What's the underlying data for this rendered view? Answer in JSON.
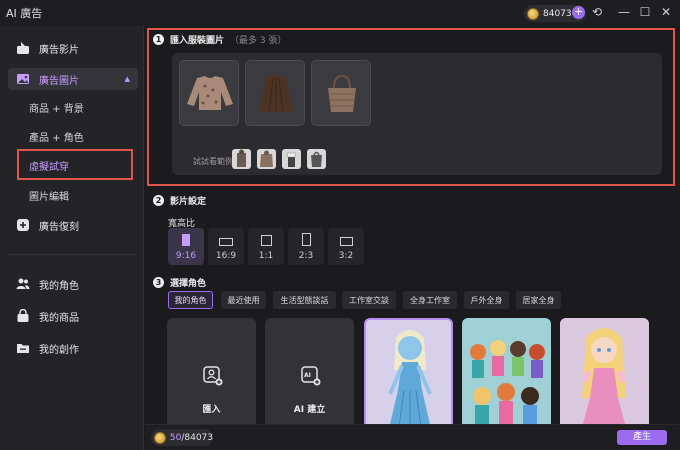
{
  "app": {
    "title": "AI 廣告"
  },
  "titlebar": {
    "credits": "84073",
    "plus": "+",
    "refresh": "⟲",
    "minimize": "—",
    "maximize": "☐",
    "close": "✕"
  },
  "sidebar": {
    "items": [
      {
        "label": "廣告影片"
      },
      {
        "label": "廣告圖片",
        "chevron": "▲"
      },
      {
        "label": "廣告復刻"
      },
      {
        "label": "我的角色"
      },
      {
        "label": "我的商品"
      },
      {
        "label": "我的創作"
      }
    ],
    "sub_items": [
      {
        "label": "商品 + 背景"
      },
      {
        "label": "產品 + 角色"
      },
      {
        "label": "虛擬試穿"
      },
      {
        "label": "圖片編輯"
      }
    ]
  },
  "section1": {
    "number": "1",
    "title": "匯入服裝圖片",
    "hint": "（最多 3 張）",
    "examples_label": "試試看範例:"
  },
  "section2": {
    "number": "2",
    "title": "影片設定",
    "ratio_label": "寬高比",
    "ratios": [
      "9:16",
      "16:9",
      "1:1",
      "2:3",
      "3:2"
    ],
    "selected_ratio": "9:16"
  },
  "section3": {
    "number": "3",
    "title": "選擇角色",
    "tabs": [
      "我的角色",
      "最近使用",
      "生活型態談話",
      "工作室交談",
      "全身工作室",
      "戶外全身",
      "居家全身"
    ],
    "active_tab": "我的角色",
    "import_label": "匯入",
    "ai_create_label": "AI 建立"
  },
  "bottom": {
    "credits_used": "50",
    "credits_total": "/84073",
    "generate": "產生"
  },
  "colors": {
    "accent": "#9b6cf0",
    "accent_text": "#c59cff",
    "highlight_border": "#e0544c"
  }
}
